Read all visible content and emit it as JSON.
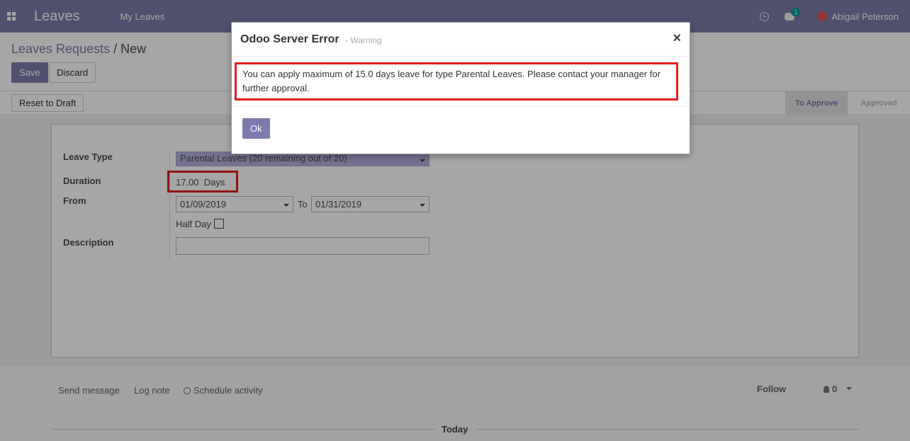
{
  "app": {
    "name": "Leaves",
    "menu": [
      "My Leaves"
    ]
  },
  "header": {
    "messages_count": "1",
    "user_name": "Abigail Peterson"
  },
  "breadcrumb": {
    "parent": "Leaves Requests",
    "separator": "/",
    "current": "New"
  },
  "buttons": {
    "save": "Save",
    "discard": "Discard",
    "reset": "Reset to Draft"
  },
  "statusbar": {
    "stages": [
      "To Approve",
      "Approved"
    ],
    "active": "To Approve"
  },
  "form": {
    "leave_type_label": "Leave Type",
    "leave_type_value": "Parental Leaves (20 remaining out of 20)",
    "duration_label": "Duration",
    "duration_value": "17.00",
    "duration_unit": "Days",
    "from_label": "From",
    "from_value": "01/09/2019",
    "to_label": "To",
    "to_value": "01/31/2019",
    "half_day_label": "Half Day",
    "half_day_checked": false,
    "description_label": "Description",
    "description_value": ""
  },
  "chatter": {
    "send_message": "Send message",
    "log_note": "Log note",
    "schedule_activity": "Schedule activity",
    "follow": "Follow",
    "followers_count": "0",
    "today": "Today"
  },
  "modal": {
    "title": "Odoo Server Error",
    "subtitle": "- Warning",
    "close": "×",
    "message": "You can apply maximum of 15.0 days leave for type Parental Leaves. Please contact your manager for further approval.",
    "ok": "Ok"
  },
  "colors": {
    "brand": "#7c7bad",
    "highlight": "#e41c1c",
    "badge": "#00a09d"
  }
}
